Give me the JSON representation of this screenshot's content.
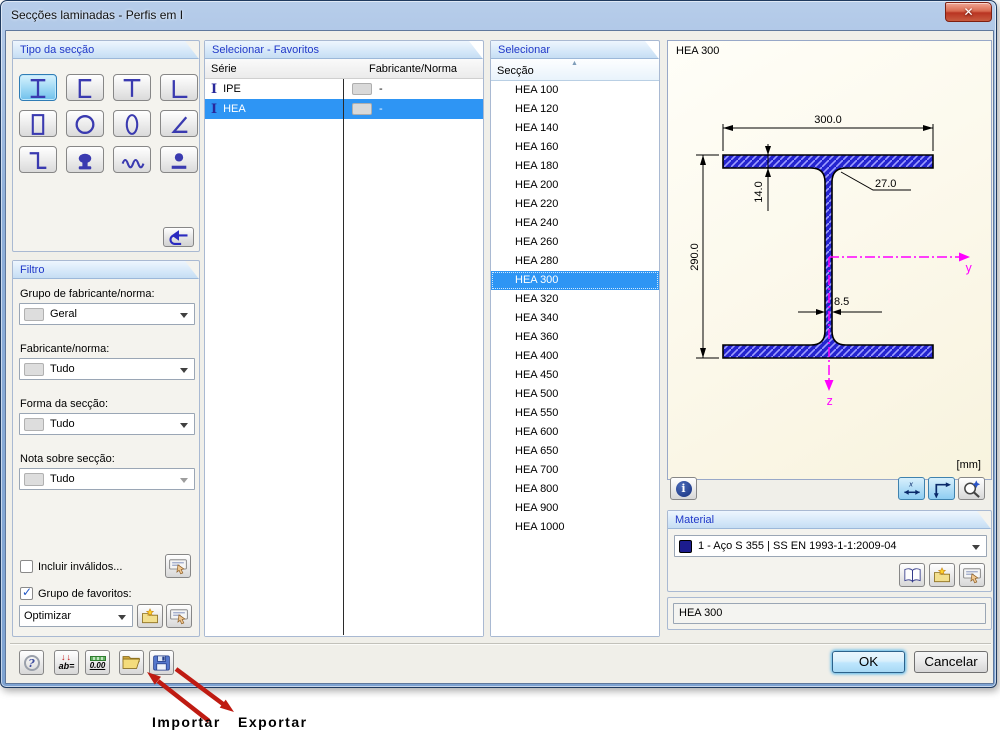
{
  "window": {
    "title": "Secções laminadas - Perfis em I",
    "close": "x"
  },
  "section_type": {
    "caption": "Tipo da secção",
    "buttons": [
      {
        "icon": "i-section",
        "selected": true
      },
      {
        "icon": "u-channel",
        "selected": false
      },
      {
        "icon": "t-section",
        "selected": false
      },
      {
        "icon": "l-angle",
        "selected": false
      },
      {
        "icon": "rect-hollow",
        "selected": false
      },
      {
        "icon": "round-hollow",
        "selected": false
      },
      {
        "icon": "oval",
        "selected": false
      },
      {
        "icon": "acute-angle",
        "selected": false
      },
      {
        "icon": "z-section",
        "selected": false
      },
      {
        "icon": "rail",
        "selected": false
      },
      {
        "icon": "corrugated",
        "selected": false
      },
      {
        "icon": "round-bar",
        "selected": false
      }
    ]
  },
  "filter": {
    "caption": "Filtro",
    "combos": [
      {
        "label": "Grupo de fabricante/norma:",
        "value": "Geral",
        "disabled": false
      },
      {
        "label": "Fabricante/norma:",
        "value": "Tudo",
        "disabled": false
      },
      {
        "label": "Forma da secção:",
        "value": "Tudo",
        "disabled": false
      },
      {
        "label": "Nota sobre secção:",
        "value": "Tudo",
        "disabled": true
      }
    ],
    "include_invalid_label": "Incluir inválidos...",
    "favorites_group_label": "Grupo de favoritos:",
    "favorites_group_value": "Optimizar"
  },
  "favorites": {
    "caption": "Selecionar - Favoritos",
    "columns": [
      "Série",
      "Fabricante/Norma"
    ],
    "rows": [
      {
        "serie": "IPE",
        "norma": "-",
        "selected": false
      },
      {
        "serie": "HEA",
        "norma": "-",
        "selected": true
      }
    ]
  },
  "sections": {
    "caption": "Selecionar",
    "column": "Secção",
    "selected": "HEA 300",
    "items": [
      "HEA 100",
      "HEA 120",
      "HEA 140",
      "HEA 160",
      "HEA 180",
      "HEA 200",
      "HEA 220",
      "HEA 240",
      "HEA 260",
      "HEA 280",
      "HEA 300",
      "HEA 320",
      "HEA 340",
      "HEA 360",
      "HEA 400",
      "HEA 450",
      "HEA 500",
      "HEA 550",
      "HEA 600",
      "HEA 650",
      "HEA 700",
      "HEA 800",
      "HEA 900",
      "HEA 1000"
    ],
    "units": "[mm]"
  },
  "preview": {
    "name": "HEA 300",
    "dim_width": "300.0",
    "dim_flange": "14.0",
    "dim_radius": "27.0",
    "dim_height": "290.0",
    "dim_web": "8.5",
    "axis_y": "y",
    "axis_z": "z"
  },
  "material": {
    "caption": "Material",
    "value": "1 - Aço S 355 | SS EN 1993-1-1:2009-04"
  },
  "section_name_value": "HEA 300",
  "footer": {
    "ok": "OK",
    "cancel": "Cancelar"
  },
  "annotation": {
    "import_label": "Importar",
    "export_label": "Exportar"
  }
}
